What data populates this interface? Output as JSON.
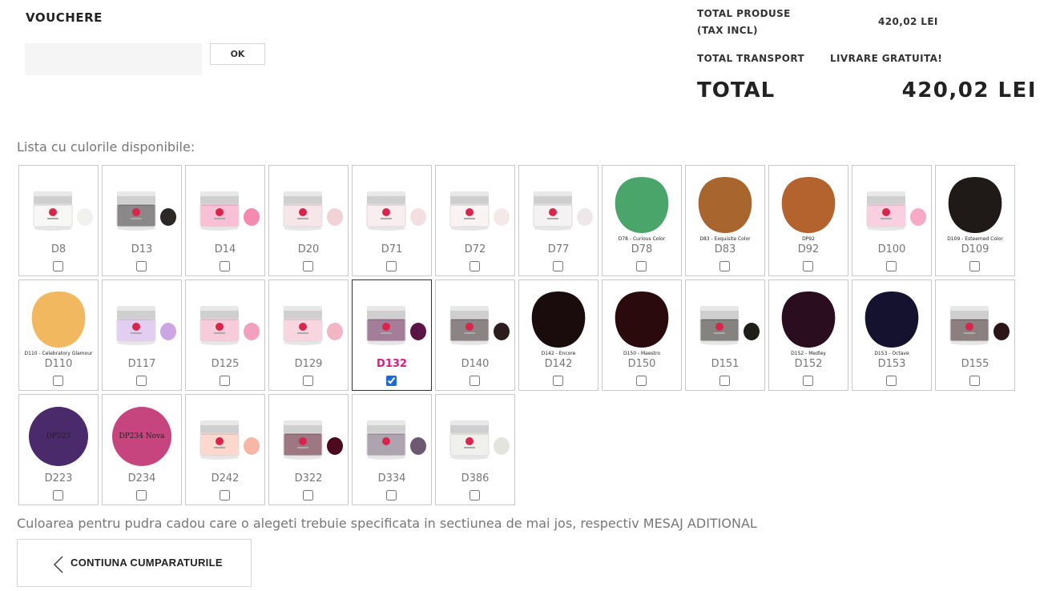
{
  "voucher": {
    "title": "VOUCHERE",
    "input_value": "",
    "ok_label": "OK"
  },
  "summary": {
    "products_label_1": "TOTAL PRODUSE",
    "products_label_2": "(TAX INCL)",
    "products_value": "420,02 LEI",
    "transport_label": "TOTAL TRANSPORT",
    "transport_value": "LIVRARE GRATUITA!",
    "total_label": "TOTAL",
    "total_value": "420,02 LEI"
  },
  "colors": {
    "title": "Lista cu culorile disponibile:",
    "items": [
      {
        "code": "D8",
        "kind": "jar",
        "swatch": "#f1f1ef",
        "checked": false
      },
      {
        "code": "D13",
        "kind": "jar",
        "swatch": "#2a2727",
        "checked": false
      },
      {
        "code": "D14",
        "kind": "jar",
        "swatch": "#f48ab0",
        "checked": false
      },
      {
        "code": "D20",
        "kind": "jar",
        "swatch": "#f1d2d7",
        "checked": false
      },
      {
        "code": "D71",
        "kind": "jar",
        "swatch": "#f3dfe2",
        "checked": false
      },
      {
        "code": "D72",
        "kind": "jar",
        "swatch": "#f4e9ea",
        "checked": false
      },
      {
        "code": "D77",
        "kind": "jar",
        "swatch": "#ede7ea",
        "checked": false
      },
      {
        "code": "D78",
        "kind": "nail",
        "swatch": "#4aa56b",
        "caption": "D78 - Curious Color",
        "checked": false
      },
      {
        "code": "D83",
        "kind": "nail",
        "swatch": "#a9652e",
        "caption": "D83 - Exquisite Color",
        "checked": false
      },
      {
        "code": "D92",
        "kind": "nail",
        "swatch": "#b4622e",
        "caption": "DP92",
        "checked": false
      },
      {
        "code": "D100",
        "kind": "jar",
        "swatch": "#f6aac6",
        "checked": false
      },
      {
        "code": "D109",
        "kind": "nail",
        "swatch": "#1f1a18",
        "caption": "D109 - Esteemed Color",
        "checked": false
      },
      {
        "code": "D110",
        "kind": "nail",
        "swatch": "#f2b860",
        "caption": "D110 - Celebratory Glamour",
        "checked": false
      },
      {
        "code": "D117",
        "kind": "jar",
        "swatch": "#cba6e3",
        "checked": false
      },
      {
        "code": "D125",
        "kind": "jar",
        "swatch": "#f2a0bd",
        "checked": false
      },
      {
        "code": "D129",
        "kind": "jar",
        "swatch": "#f1b5c6",
        "checked": false
      },
      {
        "code": "D132",
        "kind": "jar",
        "swatch": "#5a1445",
        "checked": true
      },
      {
        "code": "D140",
        "kind": "jar",
        "swatch": "#2b1d1f",
        "checked": false
      },
      {
        "code": "D142",
        "kind": "nail",
        "swatch": "#1a0c0d",
        "caption": "D142 - Encore",
        "checked": false
      },
      {
        "code": "D150",
        "kind": "nail",
        "swatch": "#2a0a0c",
        "caption": "D150 - Maestro",
        "checked": false
      },
      {
        "code": "D151",
        "kind": "jar",
        "swatch": "#1f1d17",
        "checked": false
      },
      {
        "code": "D152",
        "kind": "nail",
        "swatch": "#2a0d1f",
        "caption": "D152 - Medley",
        "checked": false
      },
      {
        "code": "D153",
        "kind": "nail",
        "swatch": "#14122e",
        "caption": "D153 - Octave",
        "checked": false
      },
      {
        "code": "D155",
        "kind": "jar",
        "swatch": "#2b1518",
        "checked": false
      },
      {
        "code": "D223",
        "kind": "circle",
        "swatch": "#4a2a6a",
        "caption": "DP223",
        "checked": false
      },
      {
        "code": "D234",
        "kind": "circle",
        "swatch": "#c6457f",
        "caption": "DP234 Nova",
        "checked": false
      },
      {
        "code": "D242",
        "kind": "jar",
        "swatch": "#f8b7a5",
        "checked": false
      },
      {
        "code": "D322",
        "kind": "jar",
        "swatch": "#4d0a1e",
        "checked": false
      },
      {
        "code": "D334",
        "kind": "jar",
        "swatch": "#6c5a70",
        "checked": false
      },
      {
        "code": "D386",
        "kind": "jar",
        "swatch": "#e4e4df",
        "checked": false
      }
    ]
  },
  "note": "Culoarea pentru pudra cadou care o alegeti trebuie specificata in sectiunea de mai jos, respectiv MESAJ ADITIONAL",
  "continue_label": "CONTIUNA CUMPARATURILE"
}
